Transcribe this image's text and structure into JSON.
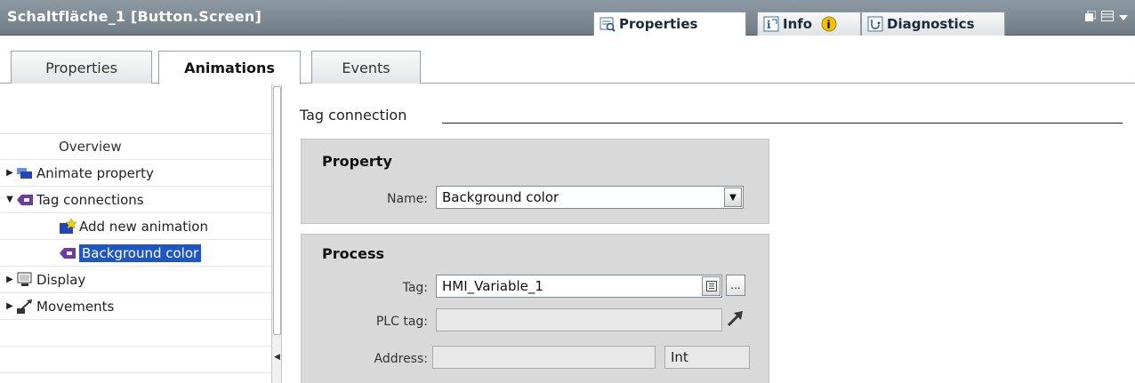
{
  "window": {
    "title": "Schaltfläche_1 [Button.Screen]"
  },
  "inspector_tabs": [
    {
      "label": "Properties",
      "icon": "properties-icon",
      "active": true
    },
    {
      "label": "Info",
      "icon": "info-icon",
      "active": false
    },
    {
      "label": "Diagnostics",
      "icon": "diagnostics-icon",
      "active": false
    }
  ],
  "tabs": [
    {
      "label": "Properties"
    },
    {
      "label": "Animations"
    },
    {
      "label": "Events"
    }
  ],
  "tree": {
    "items": [
      {
        "label": "Overview"
      },
      {
        "label": "Animate property"
      },
      {
        "label": "Tag connections"
      },
      {
        "label": "Add new animation"
      },
      {
        "label": "Background color"
      },
      {
        "label": "Display"
      },
      {
        "label": "Movements"
      }
    ]
  },
  "content": {
    "section_title": "Tag connection",
    "property_group": {
      "title": "Property",
      "name_label": "Name:",
      "name_value": "Background color"
    },
    "process_group": {
      "title": "Process",
      "tag_label": "Tag:",
      "tag_value": "HMI_Variable_1",
      "plc_tag_label": "PLC tag:",
      "plc_tag_value": "",
      "address_label": "Address:",
      "address_value": "",
      "type_value": "Int",
      "browse_label": "..."
    }
  },
  "colors": {
    "titlebar": "#7d8a94",
    "selection": "#1f56c6",
    "group_bg": "#d9d9d9"
  }
}
